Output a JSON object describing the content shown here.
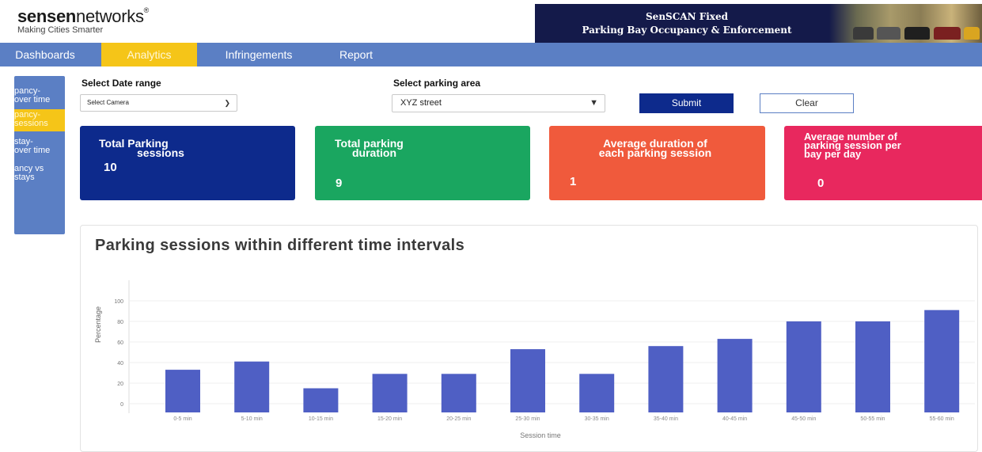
{
  "brand": {
    "name_bold": "sensen",
    "name_light": "networks",
    "mark": "®",
    "tagline": "Making Cities Smarter"
  },
  "banner": {
    "line1": "SenSCAN Fixed",
    "line2": "Parking Bay Occupancy & Enforcement"
  },
  "nav": [
    {
      "label": "Dashboards",
      "active": false
    },
    {
      "label": "Analytics",
      "active": true
    },
    {
      "label": "Infringements",
      "active": false
    },
    {
      "label": "Report",
      "active": false
    }
  ],
  "sidebar": [
    {
      "line1": "pancy-",
      "line2": "over time",
      "active": false
    },
    {
      "line1": "pancy-",
      "line2": "sessions",
      "active": true
    },
    {
      "line1": "stay-",
      "line2": "over time",
      "active": false
    },
    {
      "line1": "ancy vs",
      "line2": "stays",
      "active": false
    }
  ],
  "form": {
    "date_label": "Select Date range",
    "date_select_value": "Select Camera",
    "area_label": "Select parking area",
    "area_select_value": "XYZ street",
    "submit_label": "Submit",
    "clear_label": "Clear"
  },
  "cards": [
    {
      "title_line1": "Total Parking",
      "title_line2": "sessions",
      "value": "10",
      "color": "#0d2a8c"
    },
    {
      "title_line1": "Total parking",
      "title_line2": "duration",
      "value": "9",
      "color": "#1aa660"
    },
    {
      "title_line1": "Average duration of",
      "title_line2": "each parking session",
      "value": "1",
      "color": "#f05a3c"
    },
    {
      "title_line1": "Average number of",
      "title_line2": "parking session per",
      "title_line3": "bay per day",
      "value": "0",
      "color": "#e8285e"
    }
  ],
  "colors": {
    "accent": "#5b7fc4",
    "active": "#f5c518",
    "bar": "#4f5fc4",
    "submit": "#0d2a8c"
  },
  "chart_data": {
    "type": "bar",
    "title": "Parking sessions within different time intervals",
    "xlabel": "Session time",
    "ylabel": "Percentage",
    "ylim": [
      0,
      100
    ],
    "yticks": [
      0,
      20,
      40,
      60,
      80,
      100
    ],
    "grid": true,
    "categories": [
      "0-5 min",
      "5-10 min",
      "10-15 min",
      "15-20 min",
      "20-25 min",
      "25-30 min",
      "30-35 min",
      "35-40 min",
      "40-45 min",
      "45-50 min",
      "50-55 min",
      "55-60 min"
    ],
    "values": [
      33,
      41,
      15,
      29,
      29,
      53,
      29,
      56,
      63,
      80,
      80,
      91
    ]
  }
}
